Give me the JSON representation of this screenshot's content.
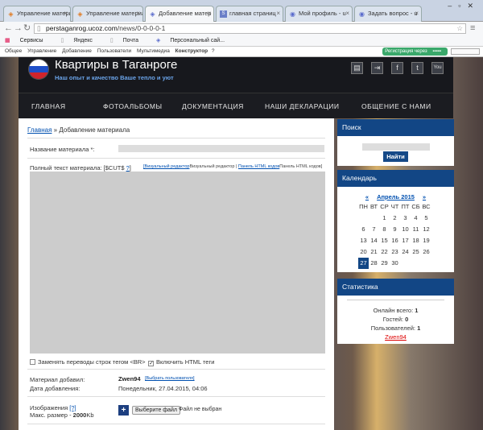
{
  "browser": {
    "tabs": [
      {
        "label": "Управление материала",
        "icon": "ucoz-icon",
        "active": false
      },
      {
        "label": "Управление материа",
        "icon": "ucoz-icon",
        "active": false
      },
      {
        "label": "Добавление матер",
        "icon": "ucoz-icon",
        "active": true
      },
      {
        "label": "главная страниц",
        "icon": "sitemap-icon",
        "active": false
      },
      {
        "label": "Мой профиль - u",
        "icon": "ucoz-icon",
        "active": false
      },
      {
        "label": "Задать вопрос - u",
        "icon": "ucoz-icon",
        "active": false
      }
    ],
    "url_domain": "perstaganrog.ucoz.com",
    "url_path": "/news/0-0-0-0-1",
    "bookmarks": [
      "Сервисы",
      "Яндекс",
      "Почта",
      "Персональный сай..."
    ]
  },
  "ucoz_bar": {
    "items": [
      "Общее",
      "Управление",
      "Добавление",
      "Пользователи",
      "Мультимедиа"
    ],
    "constructor": "Конструктор",
    "help": "?",
    "register": "Регистрация через"
  },
  "site": {
    "title": "Квартиры в Таганроге",
    "subtitle": "Наш опыт и качество Ваше тепло и уют"
  },
  "menu": [
    "ГЛАВНАЯ",
    "ФОТОАЛЬБОМЫ",
    "ДОКУМЕНТАЦИЯ",
    "НАШИ ДЕКЛАРАЦИИ",
    "ОБЩЕНИЕ С НАМИ"
  ],
  "content": {
    "crumb_home": "Главная",
    "crumb_sep": " » ",
    "crumb_current": "Добавление материала",
    "title_label": "Название материала *:",
    "fulltext_label": "Полный текст материала: [$CUT$",
    "fulltext_help": "?",
    "fulltext_end": "]",
    "editor_visual_link": "[Визуальный редактор",
    "editor_visual_text": "Визуальный редактор",
    "editor_sep": " | ",
    "editor_html_link": "Панель HTML кодов",
    "editor_html_text": "Панель HTML кодов]",
    "cb_replace": "Заменять переводы строк тегом <BR>",
    "cb_html": "Включить HTML теги",
    "author_label": "Материал добавил:",
    "author_value": "Zwen94",
    "author_choose": "[Выбрать пользователя]",
    "date_label": "Дата добавления:",
    "date_value": "Понедельник, 27.04.2015, 04:06",
    "images_label": "Изображения",
    "images_help": "[?]",
    "images_max": "Макс. размер - ",
    "images_max_val": "2000",
    "images_unit": "Kb",
    "add_button": "+",
    "choose_file": "Выберите файл",
    "no_file": "Файл не выбран"
  },
  "sidebar": {
    "search_title": "Поиск",
    "search_button": "Найти",
    "calendar_title": "Календарь",
    "cal_prev": "«",
    "cal_month": "Апрель 2015",
    "cal_next": "»",
    "weekdays": [
      "ПН",
      "ВТ",
      "СР",
      "ЧТ",
      "ПТ",
      "СБ",
      "ВС"
    ],
    "weeks": [
      [
        "",
        "",
        "1",
        "2",
        "3",
        "4",
        "5"
      ],
      [
        "6",
        "7",
        "8",
        "9",
        "10",
        "11",
        "12"
      ],
      [
        "13",
        "14",
        "15",
        "16",
        "17",
        "18",
        "19"
      ],
      [
        "20",
        "21",
        "22",
        "23",
        "24",
        "25",
        "26"
      ],
      [
        "27",
        "28",
        "29",
        "30",
        "",
        "",
        ""
      ]
    ],
    "today": "27",
    "stats_title": "Статистика",
    "online_label": "Онлайн всего: ",
    "online_value": "1",
    "guests_label": "Гостей: ",
    "guests_value": "0",
    "users_label": "Пользователей: ",
    "users_value": "1",
    "user_name": "Zwen94"
  },
  "colors": {
    "block_header": "#124685",
    "link": "#0050b0",
    "subtitle": "#6aa3e8"
  }
}
